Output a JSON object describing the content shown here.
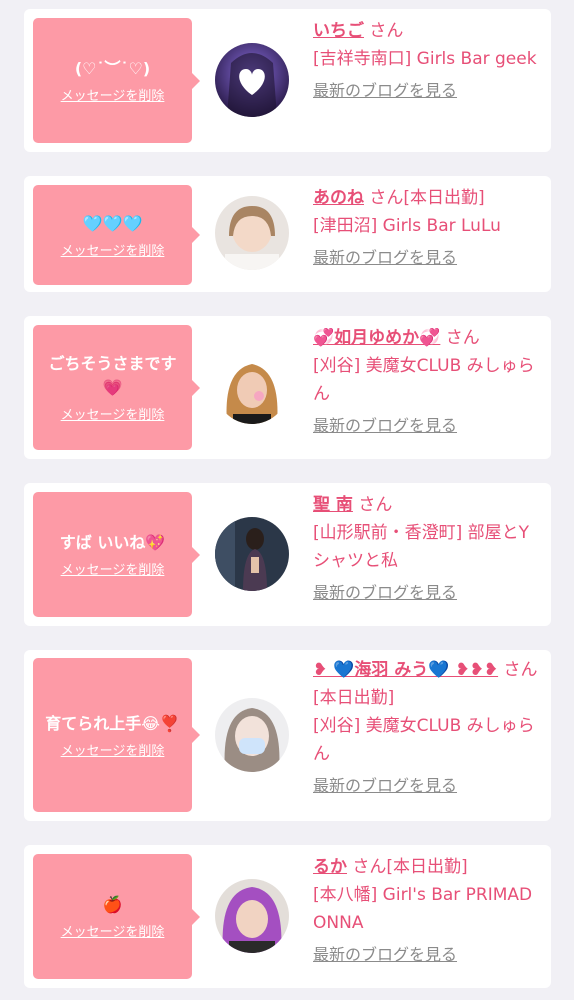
{
  "common": {
    "delete_label": "メッセージを削除",
    "blog_label": "最新のブログを見る",
    "san_label": "さん"
  },
  "colors": {
    "bubble": "#fd9aa6",
    "accent": "#e74f77",
    "link_gray": "#8b8b8b",
    "background": "#f1f0f5"
  },
  "items": [
    {
      "message": "(♡˙︶˙♡)",
      "name": "いちご",
      "status": "",
      "shop": "[吉祥寺南口] Girls Bar geek",
      "avatar": "avatar-heart-sticker-photo"
    },
    {
      "message": "🩵🩵🩵",
      "name": "あのね",
      "status": "[本日出勤]",
      "shop": "[津田沼] Girls Bar LuLu",
      "avatar": "avatar-selfie-photo"
    },
    {
      "message": "ごちそうさまです💗",
      "name": "💞如月ゆめか💞",
      "status": "",
      "shop": "[刈谷] 美魔女CLUB みしゅらん",
      "avatar": "avatar-blonde-selfie-photo"
    },
    {
      "message": "すば いいね💖",
      "name": "聖 南",
      "status": "",
      "shop": "[山形駅前・香澄町] 部屋とYシャツと私",
      "avatar": "avatar-dark-dress-photo"
    },
    {
      "message": "育てられ上手😂❣️",
      "name": "❥ 💙海羽 みう💙 ❥❥❥",
      "status": "[本日出勤]",
      "shop": "[刈谷] 美魔女CLUB みしゅらん",
      "avatar": "avatar-masked-selfie-photo"
    },
    {
      "message": "🍎",
      "name": "るか",
      "status": "[本日出勤]",
      "shop": "[本八幡] Girl's Bar PRIMADONNA",
      "avatar": "avatar-purple-hair-photo"
    }
  ]
}
